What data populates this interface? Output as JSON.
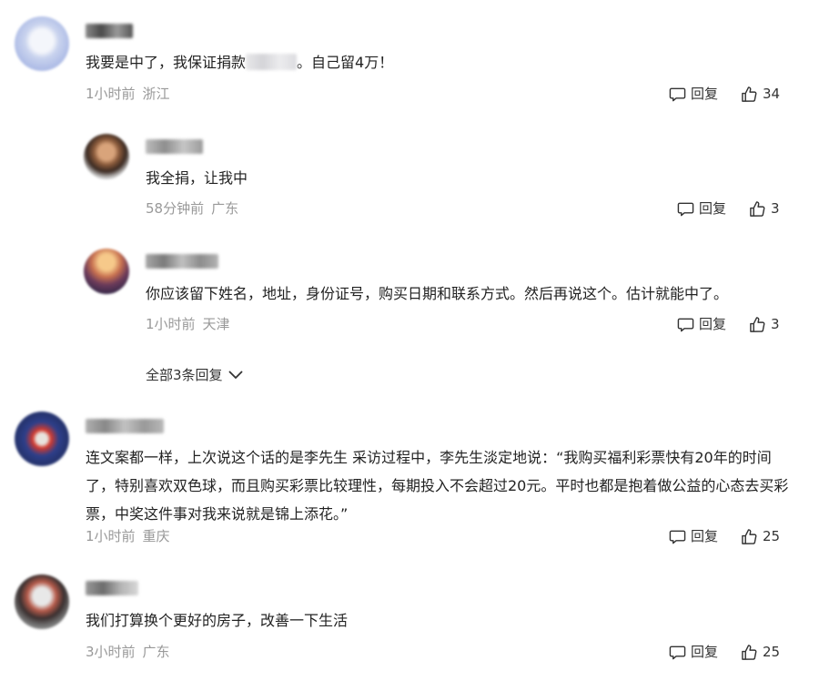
{
  "comments": [
    {
      "text_before": "我要是中了，我保证捐款",
      "text_after": "。自己留4万！",
      "time": "1小时前",
      "location": "浙江",
      "reply_label": "回复",
      "likes": "34",
      "replies": [
        {
          "text": "我全捐，让我中",
          "time": "58分钟前",
          "location": "广东",
          "reply_label": "回复",
          "likes": "3"
        },
        {
          "text": "你应该留下姓名，地址，身份证号，购买日期和联系方式。然后再说这个。估计就能中了。",
          "time": "1小时前",
          "location": "天津",
          "reply_label": "回复",
          "likes": "3"
        }
      ],
      "expand_label": "全部3条回复"
    },
    {
      "text": "连文案都一样，上次说这个话的是李先生 采访过程中，李先生淡定地说：“我购买福利彩票快有20年的时间了，特别喜欢双色球，而且购买彩票比较理性，每期投入不会超过20元。平时也都是抱着做公益的心态去买彩票，中奖这件事对我来说就是锦上添花。”",
      "time": "1小时前",
      "location": "重庆",
      "reply_label": "回复",
      "likes": "25"
    },
    {
      "text": "我们打算换个更好的房子，改善一下生活",
      "time": "3小时前",
      "location": "广东",
      "reply_label": "回复",
      "likes": "25"
    }
  ],
  "icons": {
    "reply": "comment-bubble-icon",
    "like": "thumbs-up-icon",
    "expand": "chevron-down-icon"
  },
  "colors": {
    "text": "#222222",
    "meta": "#999999",
    "action": "#333333"
  }
}
